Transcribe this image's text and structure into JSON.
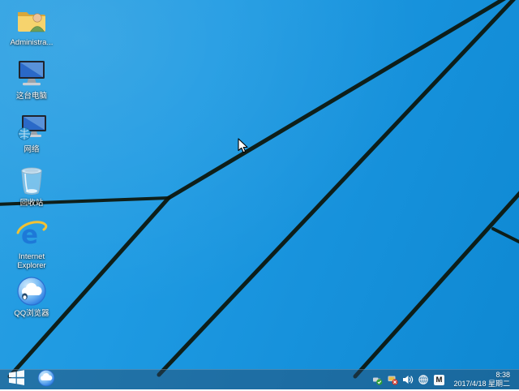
{
  "desktop": {
    "icons": [
      {
        "name": "user-folder",
        "label": "Administra..."
      },
      {
        "name": "this-pc",
        "label": "这台电脑"
      },
      {
        "name": "network",
        "label": "网络"
      },
      {
        "name": "recycle-bin",
        "label": "回收站"
      },
      {
        "name": "internet-explorer",
        "label": "Internet Explorer"
      },
      {
        "name": "qq-browser",
        "label": "QQ浏览器"
      }
    ]
  },
  "taskbar": {
    "start_icon": "windows-logo",
    "pinned": [
      {
        "name": "qq-browser-taskbar"
      }
    ],
    "tray": {
      "icon_names": [
        "safely-remove-hardware-icon",
        "device-error-icon",
        "volume-icon",
        "network-globe-icon",
        "ime-mode-icon"
      ],
      "ime_label": "M",
      "clock": {
        "time": "8:38",
        "date": "2017/4/18 星期二"
      }
    }
  },
  "colors": {
    "wallpaper_light": "#2ba0e2",
    "wallpaper_mid": "#1b97e0",
    "wallpaper_deep": "#0e88d2",
    "wallpaper_line": "#0d150b",
    "taskbar_overlay": "rgba(38,72,102,0.48)",
    "label_text": "#ffffff"
  }
}
